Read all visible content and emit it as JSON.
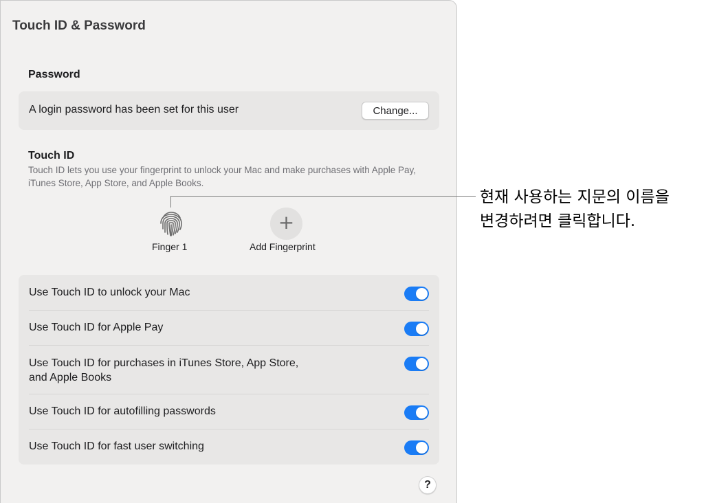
{
  "window": {
    "title": "Touch ID & Password"
  },
  "password": {
    "heading": "Password",
    "status_text": "A login password has been set for this user",
    "change_label": "Change..."
  },
  "touch_id": {
    "heading": "Touch ID",
    "description": "Touch ID lets you use your fingerprint to unlock your Mac and make purchases with Apple Pay, iTunes Store, App Store, and Apple Books.",
    "fingerprints": [
      {
        "label": "Finger 1",
        "icon": "fingerprint-icon"
      }
    ],
    "add_label": "Add Fingerprint",
    "add_icon": "plus-icon"
  },
  "options": [
    {
      "label": "Use Touch ID to unlock your Mac",
      "enabled": true
    },
    {
      "label": "Use Touch ID for Apple Pay",
      "enabled": true
    },
    {
      "label": "Use Touch ID for purchases in iTunes Store, App Store,\nand Apple Books",
      "enabled": true
    },
    {
      "label": "Use Touch ID for autofilling passwords",
      "enabled": true
    },
    {
      "label": "Use Touch ID for fast user switching",
      "enabled": true
    }
  ],
  "help": {
    "label": "?"
  },
  "callout": {
    "text": "현재 사용하는 지문의 이름을\n변경하려면 클릭합니다."
  },
  "colors": {
    "accent": "#1a7cf5",
    "window_bg": "#f2f1f0",
    "card_bg": "#e8e7e6"
  }
}
